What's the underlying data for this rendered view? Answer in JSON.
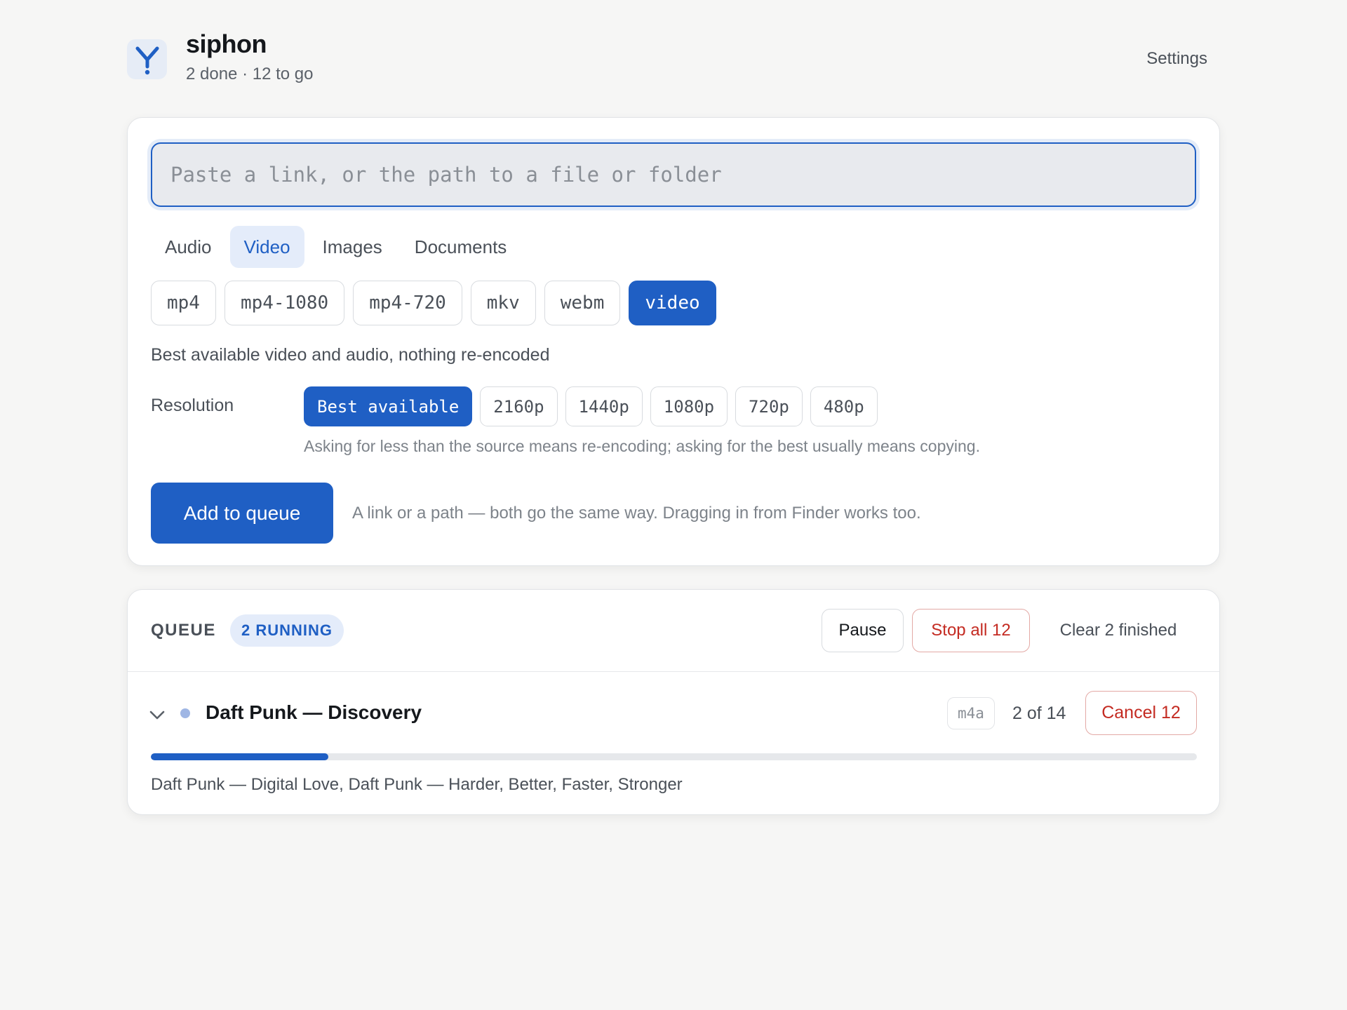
{
  "app": {
    "title": "siphon",
    "status": "2 done · 12 to go",
    "settings_label": "Settings",
    "accent_color": "#1f5fc4",
    "logo_icon": "y-fork-logo-icon"
  },
  "input": {
    "placeholder": "Paste a link, or the path to a file or folder",
    "value": ""
  },
  "tabs": [
    {
      "label": "Audio",
      "active": false
    },
    {
      "label": "Video",
      "active": true
    },
    {
      "label": "Images",
      "active": false
    },
    {
      "label": "Documents",
      "active": false
    }
  ],
  "formats": [
    {
      "label": "mp4",
      "active": false
    },
    {
      "label": "mp4-1080",
      "active": false
    },
    {
      "label": "mp4-720",
      "active": false
    },
    {
      "label": "mkv",
      "active": false
    },
    {
      "label": "webm",
      "active": false
    },
    {
      "label": "video",
      "active": true
    }
  ],
  "format_description": "Best available video and audio, nothing re-encoded",
  "resolution": {
    "label": "Resolution",
    "options": [
      {
        "label": "Best available",
        "active": true
      },
      {
        "label": "2160p",
        "active": false
      },
      {
        "label": "1440p",
        "active": false
      },
      {
        "label": "1080p",
        "active": false
      },
      {
        "label": "720p",
        "active": false
      },
      {
        "label": "480p",
        "active": false
      }
    ],
    "hint": "Asking for less than the source means re-encoding; asking for the best usually means copying."
  },
  "submit": {
    "label": "Add to queue",
    "hint": "A link or a path — both go the same way. Dragging in from Finder works too."
  },
  "queue": {
    "label": "QUEUE",
    "running_badge": "2 RUNNING",
    "pause_label": "Pause",
    "stop_label": "Stop all 12",
    "clear_label": "Clear 2 finished",
    "danger_color": "#c42b22",
    "jobs": [
      {
        "title": "Daft Punk — Discovery",
        "format": "m4a",
        "progress_text": "2 of 14",
        "progress_fraction": 0.17,
        "cancel_label": "Cancel 12",
        "completed": "Daft Punk — Digital Love, Daft Punk — Harder, Better, Faster, Stronger",
        "expand_icon": "chevron-down-icon"
      }
    ]
  }
}
